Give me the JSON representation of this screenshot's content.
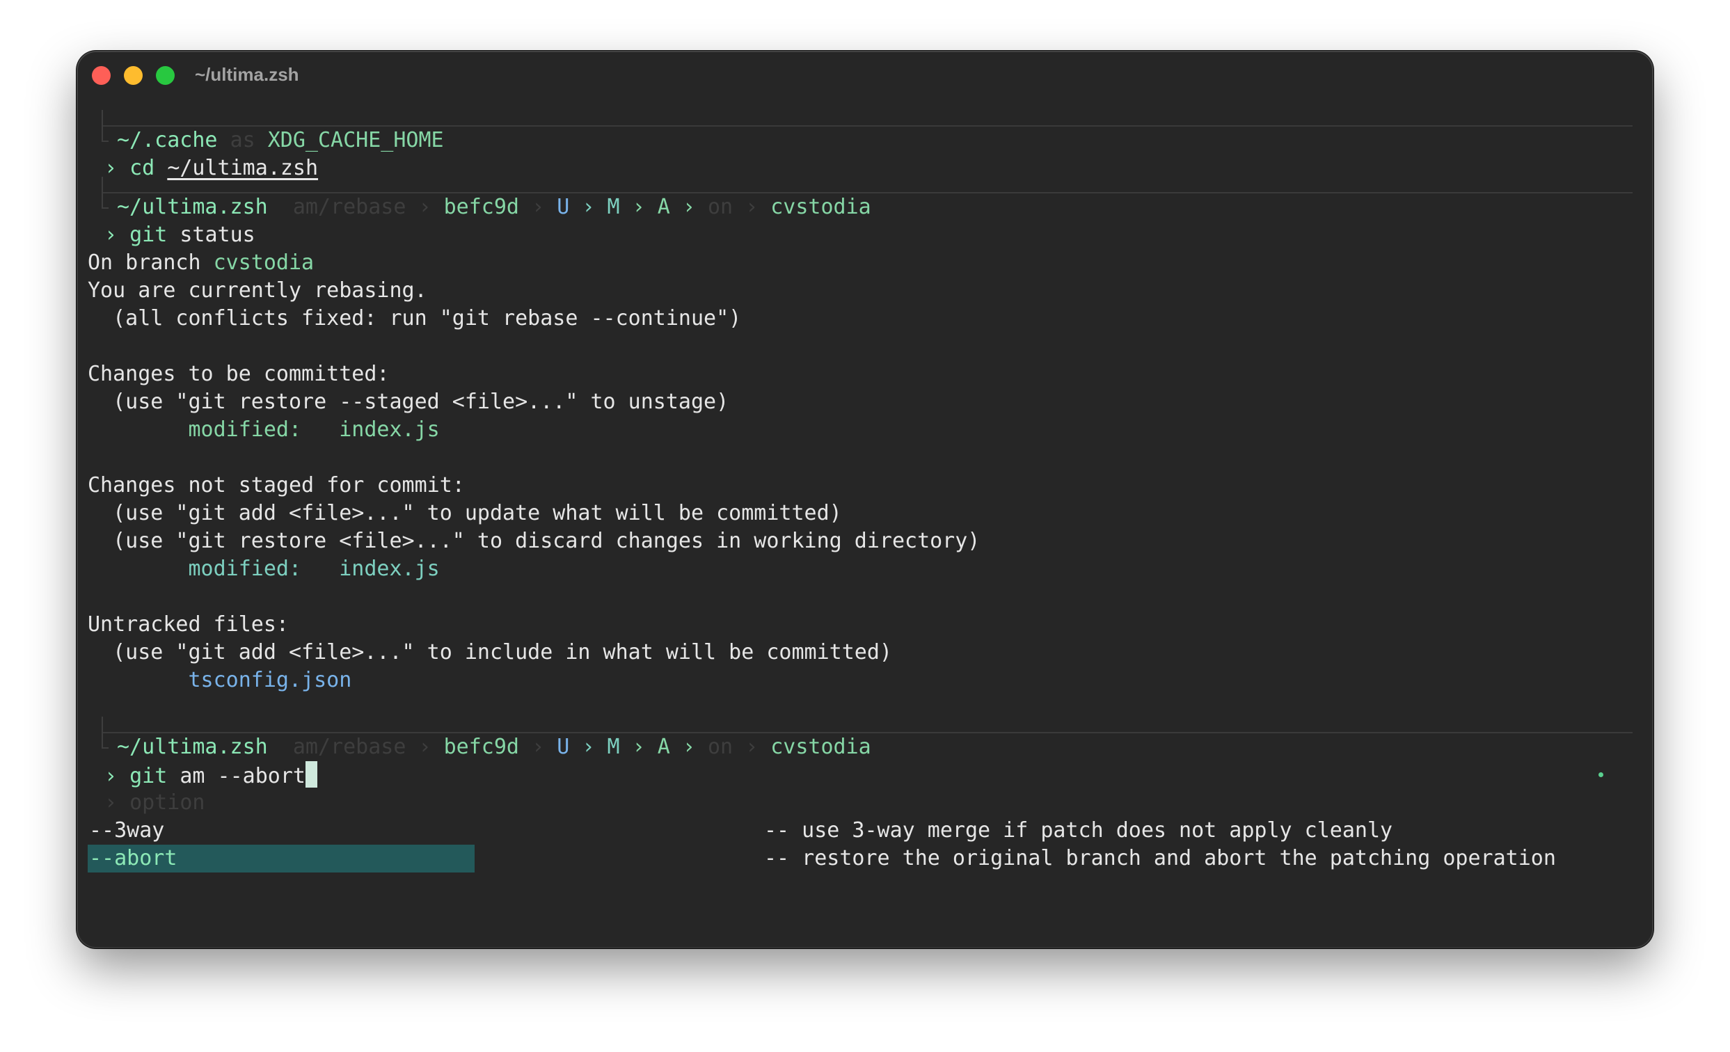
{
  "window": {
    "title": "~/ultima.zsh"
  },
  "block1": {
    "path": "~/.cache",
    "as_word": "as",
    "alias": "XDG_CACHE_HOME",
    "prompt_char": "›",
    "cmd": "cd",
    "arg": "~/ultima.zsh"
  },
  "block2": {
    "path": "~/ultima.zsh",
    "op": "am/rebase",
    "sep1": "›",
    "hash": "befc9d",
    "sep2": "›",
    "flag_u": "U",
    "sep3": "›",
    "flag_m": "M",
    "sep4": "›",
    "flag_a": "A",
    "sep5": "›",
    "on_word": "on",
    "sep6": "›",
    "branch": "cvstodia",
    "prompt_char": "›",
    "cmd": "git",
    "args": "status"
  },
  "output": {
    "on_branch_label": "On branch ",
    "on_branch_name": "cvstodia",
    "rebasing": "You are currently rebasing.",
    "conflicts_hint": "(all conflicts fixed: run \"git rebase --continue\")",
    "staged_header": "Changes to be committed:",
    "staged_hint": "(use \"git restore --staged <file>...\" to unstage)",
    "staged_status": "modified:",
    "staged_file": "index.js",
    "unstaged_header": "Changes not staged for commit:",
    "unstaged_hint1": "(use \"git add <file>...\" to update what will be committed)",
    "unstaged_hint2": "(use \"git restore <file>...\" to discard changes in working directory)",
    "unstaged_status": "modified:",
    "unstaged_file": "index.js",
    "untracked_header": "Untracked files:",
    "untracked_hint": "(use \"git add <file>...\" to include in what will be committed)",
    "untracked_file": "tsconfig.json"
  },
  "block3": {
    "path": "~/ultima.zsh",
    "op": "am/rebase",
    "sep1": "›",
    "hash": "befc9d",
    "sep2": "›",
    "flag_u": "U",
    "sep3": "›",
    "flag_m": "M",
    "sep4": "›",
    "flag_a": "A",
    "sep5": "›",
    "on_word": "on",
    "sep6": "›",
    "branch": "cvstodia",
    "prompt_char": "›",
    "cmd": "git",
    "args": "am --abort"
  },
  "completion": {
    "group_char": "›",
    "group_label": "option",
    "items": [
      {
        "option": "--3way",
        "description": "-- use 3-way merge if patch does not apply cleanly",
        "selected": false
      },
      {
        "option": "--abort",
        "description": "-- restore the original branch and abort the patching operation",
        "selected": true
      }
    ]
  },
  "colors": {
    "background": "#262626",
    "path": "#8ce8b6",
    "branch": "#86d7a6",
    "flag_u": "#79b3ea",
    "staged": "#86d7a6",
    "unstaged": "#7dd0c0",
    "untracked": "#79b3ea",
    "selection": "#23595a"
  }
}
